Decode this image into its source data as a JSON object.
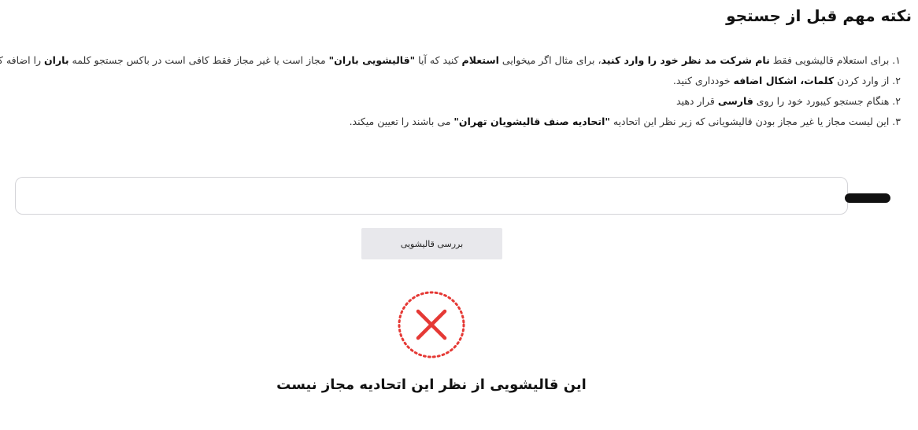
{
  "heading": "نکته مهم قبل از جستجو",
  "notes": [
    {
      "p1": "۱. برای استعلام قالیشویی فقط ",
      "b1": "نام شرکت مد نظر خود را وارد کنید",
      "p2": "، برای مثال اگر میخوایی ",
      "b2": "استعلام",
      "p3": " کنید که آیا ",
      "b3": "\"قالیشویی باران\"",
      "p4": " مجاز است یا غیر مجاز فقط کافی است در باکس جستجو کلمه ",
      "b4": "باران",
      "p5": " را اضافه کنید."
    },
    {
      "p1": "۲. از وارد کردن ",
      "b1": "کلمات، اشکال اضافه",
      "p2": " خودداری کنید."
    },
    {
      "p1": "۲. هنگام جستجو کیبورد خود را روی ",
      "b1": "فارسی",
      "p2": " قرار دهید"
    },
    {
      "p1": "۳. این لیست مجاز یا غیر مجاز بودن قالیشویانی که زیر نظر این اتحادیه ",
      "b1": "\"اتحادیه صنف قالیشویان تهران\"",
      "p2": " می باشند را تعیین میکند."
    }
  ],
  "search": {
    "value": "redacted"
  },
  "check_button": "بررسی قالیشویی",
  "result": {
    "icon": "x-mark-icon",
    "icon_color": "#e53935",
    "message": "این قالیشویی از نظر این اتحادیه مجاز نیست"
  }
}
